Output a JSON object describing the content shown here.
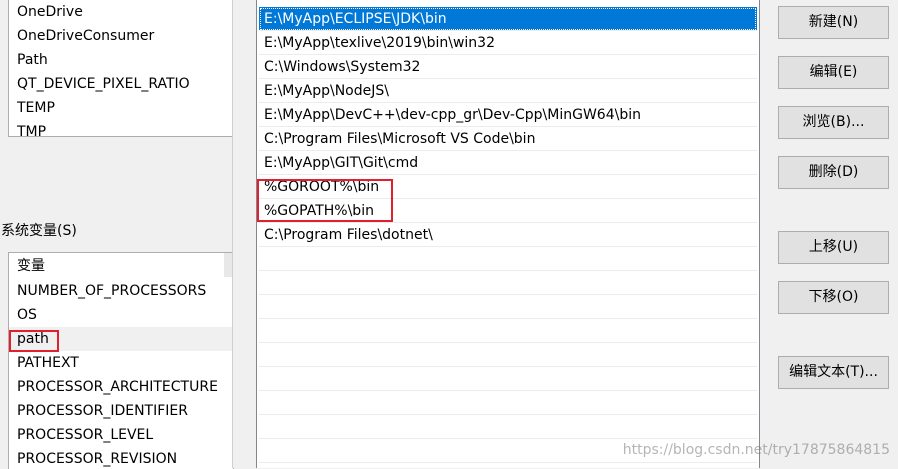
{
  "user_vars": [
    "OneDrive",
    "OneDriveConsumer",
    "Path",
    "QT_DEVICE_PIXEL_RATIO",
    "TEMP",
    "TMP"
  ],
  "system_vars_label": "系统变量(S)",
  "system_vars_header": "变量",
  "system_vars": [
    "NUMBER_OF_PROCESSORS",
    "OS",
    "path",
    "PATHEXT",
    "PROCESSOR_ARCHITECTURE",
    "PROCESSOR_IDENTIFIER",
    "PROCESSOR_LEVEL",
    "PROCESSOR_REVISION"
  ],
  "path_entries": [
    "E:\\MyApp\\ECLIPSE\\JDK\\bin",
    "E:\\MyApp\\texlive\\2019\\bin\\win32",
    "C:\\Windows\\System32",
    "E:\\MyApp\\NodeJS\\",
    "E:\\MyApp\\DevC++\\dev-cpp_gr\\Dev-Cpp\\MinGW64\\bin",
    "C:\\Program Files\\Microsoft VS Code\\bin",
    "E:\\MyApp\\GIT\\Git\\cmd",
    "%GOROOT%\\bin",
    "%GOPATH%\\bin",
    "C:\\Program Files\\dotnet\\"
  ],
  "buttons": {
    "new": "新建(N)",
    "edit": "编辑(E)",
    "browse": "浏览(B)...",
    "delete": "删除(D)",
    "move_up": "上移(U)",
    "move_down": "下移(O)",
    "edit_text": "编辑文本(T)..."
  },
  "watermark": "https://blog.csdn.net/try17875864815",
  "colors": {
    "selection": "#0078d7",
    "highlight_box": "#e0202c"
  }
}
